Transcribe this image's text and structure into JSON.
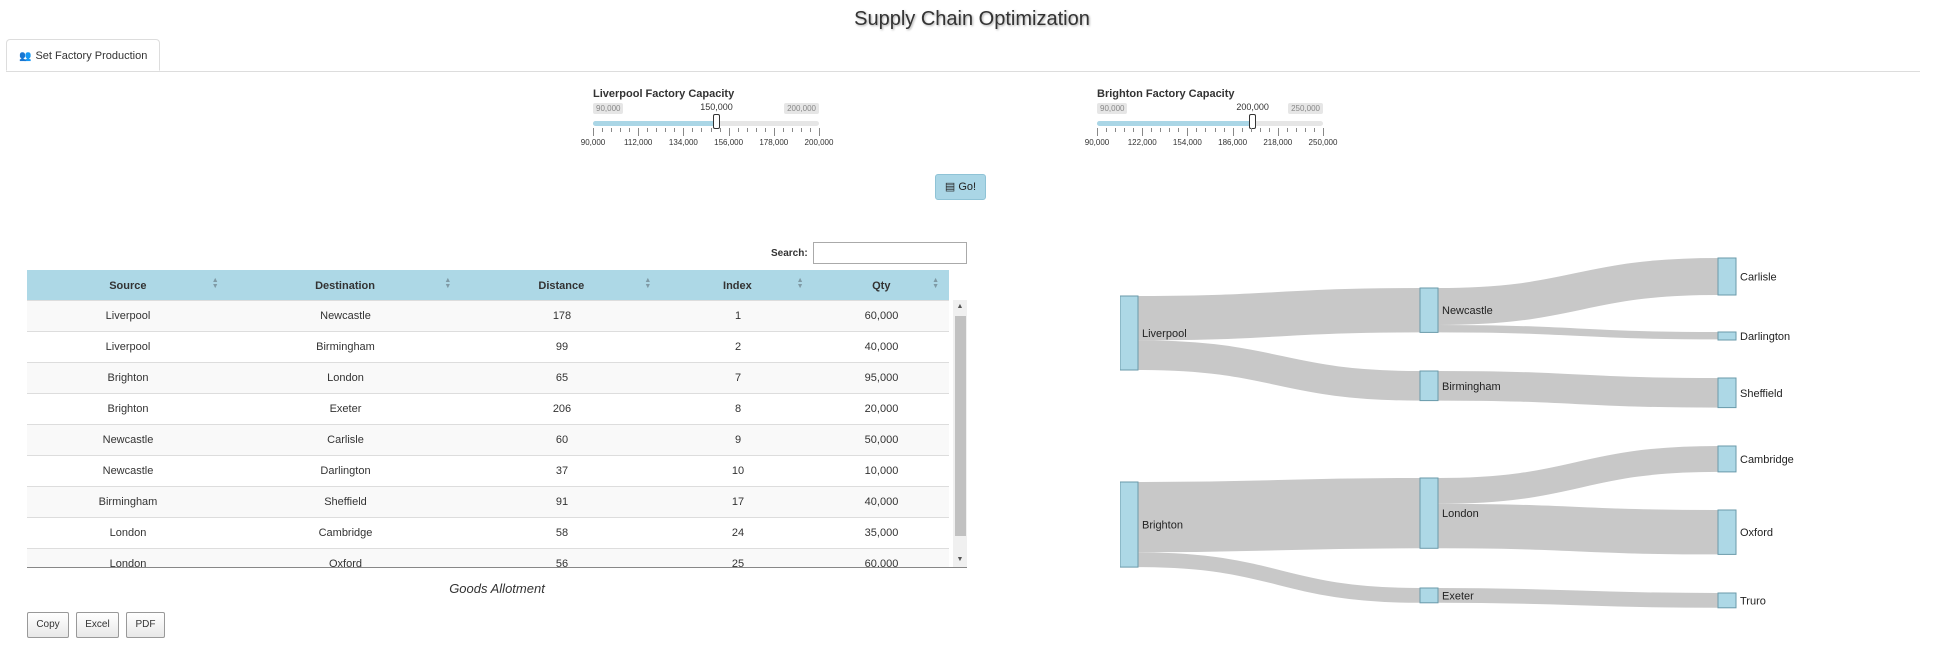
{
  "title": "Supply Chain Optimization",
  "tab": {
    "label": "Set Factory Production",
    "icon": "users-icon"
  },
  "sliders": [
    {
      "label": "Liverpool Factory Capacity",
      "min": 90000,
      "max": 200000,
      "value": 150000,
      "min_label": "90,000",
      "max_label": "200,000",
      "value_label": "150,000",
      "ticks": [
        "90,000",
        "112,000",
        "134,000",
        "156,000",
        "178,000",
        "200,000"
      ]
    },
    {
      "label": "Brighton Factory Capacity",
      "min": 90000,
      "max": 250000,
      "value": 200000,
      "min_label": "90,000",
      "max_label": "250,000",
      "value_label": "200,000",
      "ticks": [
        "90,000",
        "122,000",
        "154,000",
        "186,000",
        "218,000",
        "250,000"
      ]
    }
  ],
  "go_button": {
    "label": "Go!",
    "icon": "chart-icon"
  },
  "search": {
    "label": "Search:",
    "value": ""
  },
  "table": {
    "columns": [
      "Source",
      "Destination",
      "Distance",
      "Index",
      "Qty"
    ],
    "rows": [
      [
        "Liverpool",
        "Newcastle",
        "178",
        "1",
        "60,000"
      ],
      [
        "Liverpool",
        "Birmingham",
        "99",
        "2",
        "40,000"
      ],
      [
        "Brighton",
        "London",
        "65",
        "7",
        "95,000"
      ],
      [
        "Brighton",
        "Exeter",
        "206",
        "8",
        "20,000"
      ],
      [
        "Newcastle",
        "Carlisle",
        "60",
        "9",
        "50,000"
      ],
      [
        "Newcastle",
        "Darlington",
        "37",
        "10",
        "10,000"
      ],
      [
        "Birmingham",
        "Sheffield",
        "91",
        "17",
        "40,000"
      ],
      [
        "London",
        "Cambridge",
        "58",
        "24",
        "35,000"
      ],
      [
        "London",
        "Oxford",
        "56",
        "25",
        "60,000"
      ]
    ],
    "caption": "Goods Allotment"
  },
  "export_buttons": [
    "Copy",
    "Excel",
    "PDF"
  ],
  "sankey": {
    "nodes": [
      "Liverpool",
      "Brighton",
      "Newcastle",
      "Birmingham",
      "London",
      "Exeter",
      "Carlisle",
      "Darlington",
      "Sheffield",
      "Cambridge",
      "Oxford",
      "Truro"
    ],
    "links": [
      {
        "source": "Liverpool",
        "target": "Newcastle",
        "value": 60000
      },
      {
        "source": "Liverpool",
        "target": "Birmingham",
        "value": 40000
      },
      {
        "source": "Brighton",
        "target": "London",
        "value": 95000
      },
      {
        "source": "Brighton",
        "target": "Exeter",
        "value": 20000
      },
      {
        "source": "Newcastle",
        "target": "Carlisle",
        "value": 50000
      },
      {
        "source": "Newcastle",
        "target": "Darlington",
        "value": 10000
      },
      {
        "source": "Birmingham",
        "target": "Sheffield",
        "value": 40000
      },
      {
        "source": "London",
        "target": "Cambridge",
        "value": 35000
      },
      {
        "source": "London",
        "target": "Oxford",
        "value": 60000
      },
      {
        "source": "Exeter",
        "target": "Truro",
        "value": 20000
      }
    ]
  },
  "colors": {
    "accent": "#add8e6",
    "link": "#c8c8c8"
  }
}
